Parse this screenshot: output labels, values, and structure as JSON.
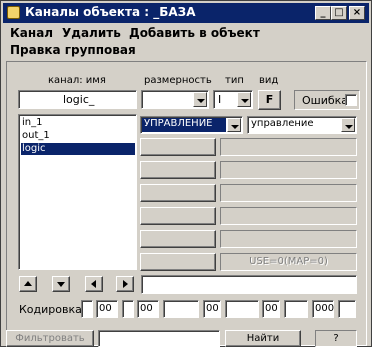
{
  "window": {
    "title": "Каналы объекта : _БАЗА"
  },
  "menu": {
    "row1": [
      "Канал",
      "Удалить",
      "Добавить в объект"
    ],
    "row2": [
      "Правка групповая"
    ]
  },
  "headers": {
    "channel_name": "канал: имя",
    "dimension": "размерность",
    "type": "тип",
    "view": "вид"
  },
  "name_field": {
    "value": "logic_"
  },
  "type_select": {
    "value": "I"
  },
  "view_button": {
    "label": "F"
  },
  "error_checkbox": {
    "label": "Ошибка",
    "checked": false
  },
  "channels": [
    "in_1",
    "out_1",
    "logic"
  ],
  "selected_channel": "logic",
  "mode_select": {
    "value": "УПРАВЛЕНИЕ"
  },
  "mode_select2": {
    "value": "управление"
  },
  "status_text": "USE=0(MAP=0)",
  "coding": {
    "label": "Кодировка",
    "values": [
      "00",
      "00",
      "00",
      "00",
      "000"
    ]
  },
  "filter_button": {
    "label": "Фильтровать"
  },
  "find_button": {
    "label": "Найти"
  },
  "counter": {
    "value": "?"
  },
  "colors": {
    "titlebar": "#0a246a",
    "face": "#d4d0c8",
    "selection": "#0a246a"
  }
}
